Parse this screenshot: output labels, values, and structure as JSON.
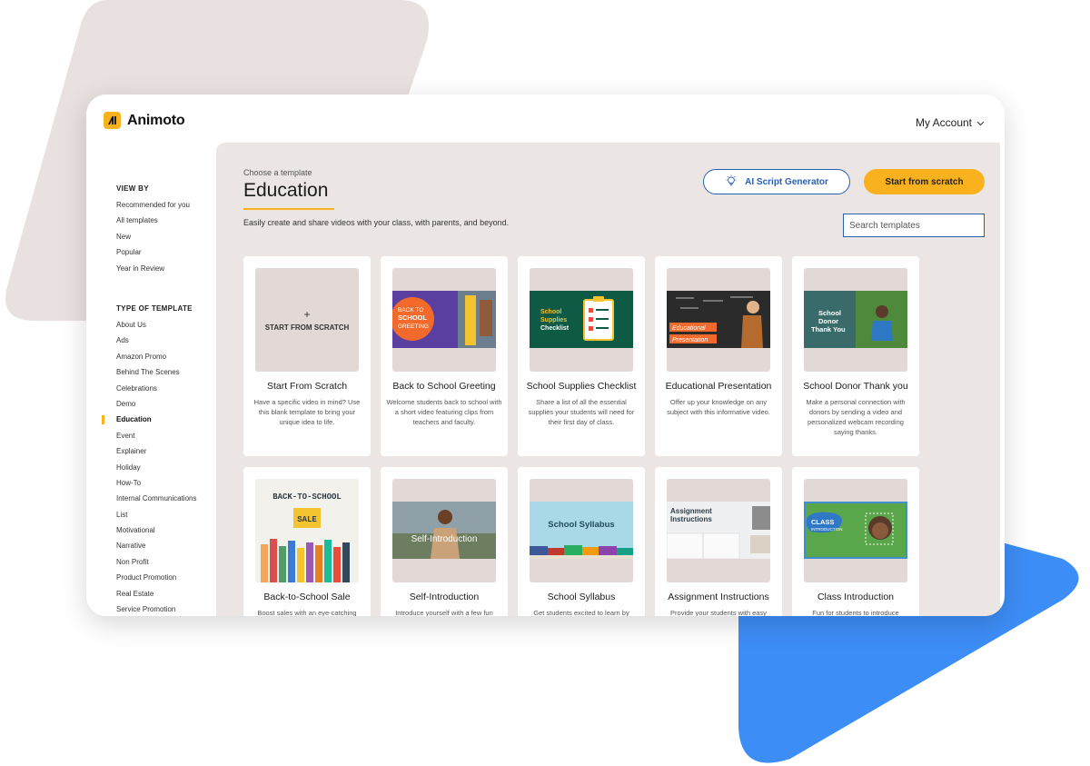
{
  "app": {
    "brand": "Animoto",
    "account_label": "My Account"
  },
  "sidebar": {
    "view_by_heading": "VIEW BY",
    "view_by": [
      "Recommended for you",
      "All templates",
      "New",
      "Popular",
      "Year in Review"
    ],
    "type_heading": "TYPE OF TEMPLATE",
    "types": [
      "About Us",
      "Ads",
      "Amazon Promo",
      "Behind The Scenes",
      "Celebrations",
      "Demo",
      "Education",
      "Event",
      "Explainer",
      "Holiday",
      "How-To",
      "Internal Communications",
      "List",
      "Motivational",
      "Narrative",
      "Non Profit",
      "Product Promotion",
      "Real Estate",
      "Service Promotion"
    ],
    "active_type": "Education"
  },
  "main": {
    "eyebrow": "Choose a template",
    "title": "Education",
    "subtitle": "Easily create and share videos with your class, with parents, and beyond.",
    "ai_button": "AI Script Generator",
    "scratch_button": "Start from scratch",
    "search_placeholder": "Search templates"
  },
  "cards": [
    {
      "title": "Start From Scratch",
      "desc": "Have a specific video in mind? Use this blank template to bring your unique idea to life.",
      "thumb_label": "START FROM SCRATCH",
      "thumb_plus": "+"
    },
    {
      "title": "Back to School Greeting",
      "desc": "Welcome students back to school with a short video featuring clips from teachers and faculty.",
      "thumb_lines": [
        "BACK TO",
        "SCHOOL",
        "GREETING"
      ]
    },
    {
      "title": "School Supplies Checklist",
      "desc": "Share a list of all the essential supplies your students will need for their first day of class.",
      "thumb_lines": [
        "School",
        "Supplies",
        "Checklist"
      ]
    },
    {
      "title": "Educational Presentation",
      "desc": "Offer up your knowledge on any subject with this informative video.",
      "thumb_lines": [
        "Educational",
        "Presentation"
      ]
    },
    {
      "title": "School Donor Thank you",
      "desc": "Make a personal connection with donors by sending a video and personalized webcam recording saying thanks.",
      "thumb_lines": [
        "School",
        "Donor",
        "Thank You"
      ]
    },
    {
      "title": "Back-to-School Sale",
      "desc": "Boost sales with an eye-catching",
      "thumb_lines": [
        "BACK-TO-SCHOOL",
        "SALE"
      ]
    },
    {
      "title": "Self-Introduction",
      "desc": "Introduce yourself with a few fun",
      "thumb_lines": [
        "Self-Introduction"
      ]
    },
    {
      "title": "School Syllabus",
      "desc": "Get students excited to learn by",
      "thumb_lines": [
        "School Syllabus"
      ]
    },
    {
      "title": "Assignment Instructions",
      "desc": "Provide your students with easy",
      "thumb_lines": [
        "Assignment",
        "Instructions"
      ]
    },
    {
      "title": "Class Introduction",
      "desc": "Fun for students to introduce",
      "thumb_lines": [
        "CLASS",
        "INTRODUCTION"
      ]
    }
  ],
  "colors": {
    "accent": "#f9b21e",
    "link_blue": "#2a5fb0",
    "panel_bg": "#ebe6e4",
    "deco_beige": "#e8e1e0",
    "deco_blue": "#3d8df6"
  }
}
